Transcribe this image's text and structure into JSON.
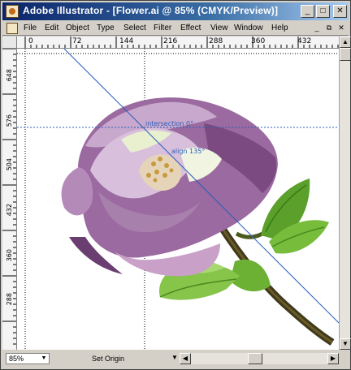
{
  "window": {
    "title": "Adobe Illustrator - [Flower.ai @ 85% (CMYK/Preview)]",
    "minimize_glyph": "_",
    "maximize_glyph": "□",
    "close_glyph": "✕"
  },
  "menu": {
    "items": [
      "File",
      "Edit",
      "Object",
      "Type",
      "Select",
      "Filter",
      "Effect",
      "View",
      "Window",
      "Help"
    ],
    "doc_minimize_glyph": "_",
    "doc_restore_glyph": "⧉",
    "doc_close_glyph": "✕"
  },
  "rulers": {
    "horizontal": [
      "0",
      "72",
      "144",
      "216",
      "288",
      "360",
      "432"
    ],
    "vertical": [
      "648",
      "576",
      "504",
      "432",
      "360",
      "288"
    ]
  },
  "canvas": {
    "guide_labels": [
      "intersection 0°",
      "align 135°"
    ]
  },
  "status": {
    "zoom": "85%",
    "tool": "Set Origin"
  },
  "icons": {
    "app": "illustrator-app-icon",
    "doc": "document-icon"
  },
  "colors": {
    "titlebar_start": "#0a246a",
    "titlebar_end": "#a6caf0",
    "guide": "#2a5db8",
    "petal": "#b48ab8",
    "leaf": "#5aa02a"
  }
}
